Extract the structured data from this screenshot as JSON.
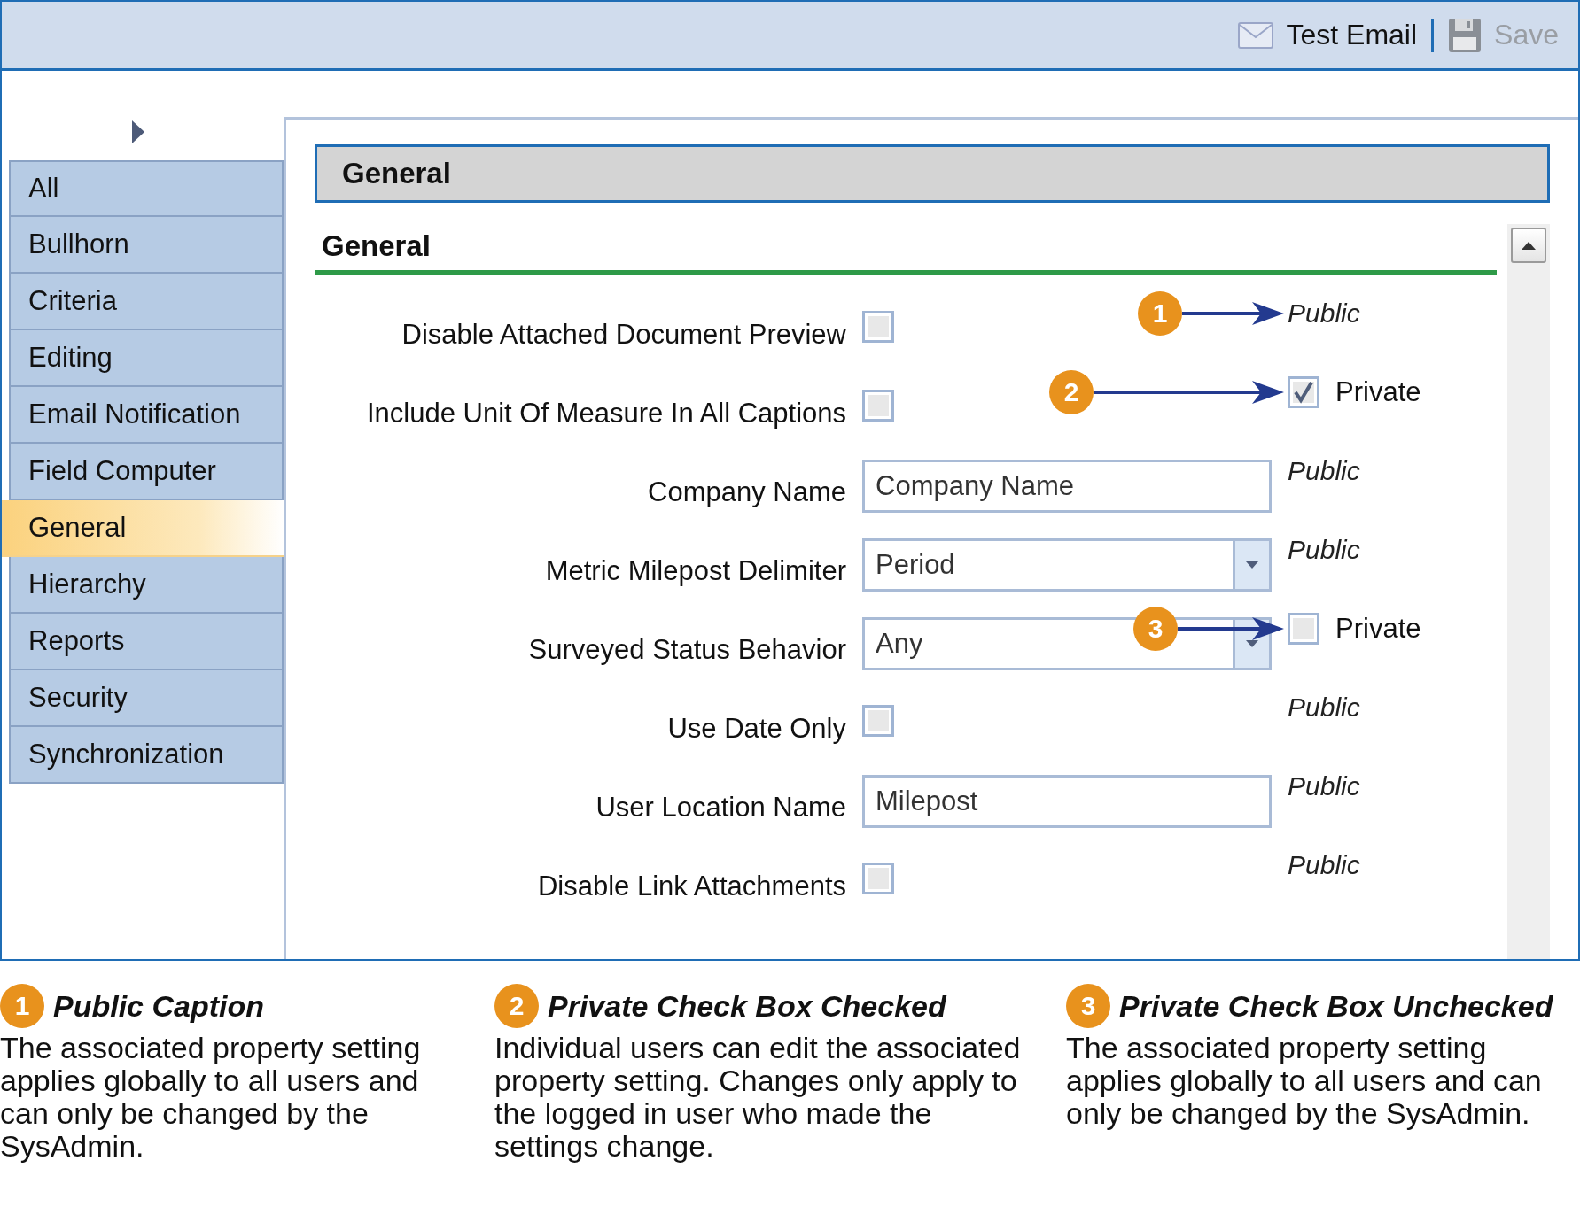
{
  "toolbar": {
    "buttons": [
      {
        "label": "Test Email",
        "kind": "email",
        "disabled": false
      },
      {
        "label": "Save",
        "kind": "save",
        "disabled": true
      }
    ]
  },
  "sidebar": {
    "items": [
      {
        "label": "All",
        "selected": false
      },
      {
        "label": "Bullhorn",
        "selected": false
      },
      {
        "label": "Criteria",
        "selected": false
      },
      {
        "label": "Editing",
        "selected": false
      },
      {
        "label": "Email Notification",
        "selected": false
      },
      {
        "label": "Field Computer",
        "selected": false
      },
      {
        "label": "General",
        "selected": true
      },
      {
        "label": "Hierarchy",
        "selected": false
      },
      {
        "label": "Reports",
        "selected": false
      },
      {
        "label": "Security",
        "selected": false
      },
      {
        "label": "Synchronization",
        "selected": false
      }
    ]
  },
  "panel": {
    "header": "General",
    "section": "General",
    "rows": [
      {
        "label": "Disable Attached Document Preview",
        "kind": "checkbox",
        "checked": false,
        "scope": {
          "kind": "caption",
          "text": "Public"
        },
        "callout": "1"
      },
      {
        "label": "Include Unit Of Measure In All Captions",
        "kind": "checkbox",
        "checked": false,
        "scope": {
          "kind": "private",
          "text": "Private",
          "checked": true
        },
        "callout": "2"
      },
      {
        "label": "Company Name",
        "kind": "text",
        "value": "Company Name",
        "scope": {
          "kind": "caption",
          "text": "Public"
        }
      },
      {
        "label": "Metric Milepost Delimiter",
        "kind": "combo",
        "value": "Period",
        "scope": {
          "kind": "caption",
          "text": "Public"
        }
      },
      {
        "label": "Surveyed Status Behavior",
        "kind": "combo",
        "value": "Any",
        "scope": {
          "kind": "private",
          "text": "Private",
          "checked": false
        },
        "callout": "3"
      },
      {
        "label": "Use Date Only",
        "kind": "checkbox",
        "checked": false,
        "scope": {
          "kind": "caption",
          "text": "Public"
        }
      },
      {
        "label": "User Location Name",
        "kind": "text",
        "value": "Milepost",
        "scope": {
          "kind": "caption",
          "text": "Public"
        }
      },
      {
        "label": "Disable Link Attachments",
        "kind": "checkbox",
        "checked": false,
        "scope": {
          "kind": "caption",
          "text": "Public"
        }
      }
    ]
  },
  "callouts": [
    {
      "number": "1",
      "title": "Public Caption",
      "text": "The associated property setting applies globally to all users and can only be changed by the SysAdmin."
    },
    {
      "number": "2",
      "title": "Private Check Box Checked",
      "text": "Individual users can edit the associated property setting. Changes only apply to the logged in user who made the settings change."
    },
    {
      "number": "3",
      "title": "Private Check Box Unchecked",
      "text": "The associated property setting applies globally to all users and can only be changed by the SysAdmin."
    }
  ]
}
